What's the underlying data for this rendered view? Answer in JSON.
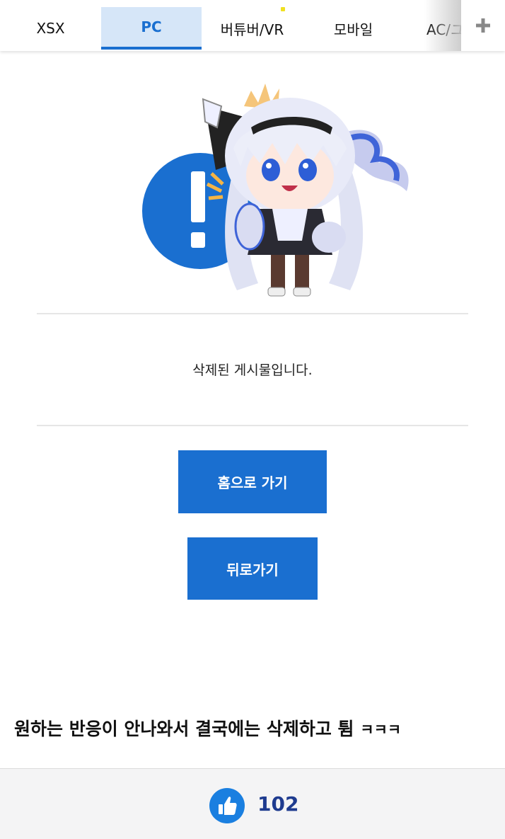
{
  "tabs": [
    {
      "label": "XSX",
      "active": false
    },
    {
      "label": "PC",
      "active": true
    },
    {
      "label": "버튜버/VR",
      "active": false
    },
    {
      "label": "모바일",
      "active": false
    },
    {
      "label": "AC/ユ",
      "active": false
    }
  ],
  "colors": {
    "accent": "#1a6fd0",
    "active_tab_bg": "#d6e6f8",
    "like_count": "#1e3b8f"
  },
  "notice": {
    "message": "삭제된 게시물입니다."
  },
  "buttons": {
    "home": "홈으로 가기",
    "back": "뒤로가기"
  },
  "caption": {
    "main": "원하는 반응이 안나와서 결국에는 삭제하고 튐",
    "laugh": "ㅋㅋㅋ"
  },
  "like": {
    "count": "102"
  }
}
